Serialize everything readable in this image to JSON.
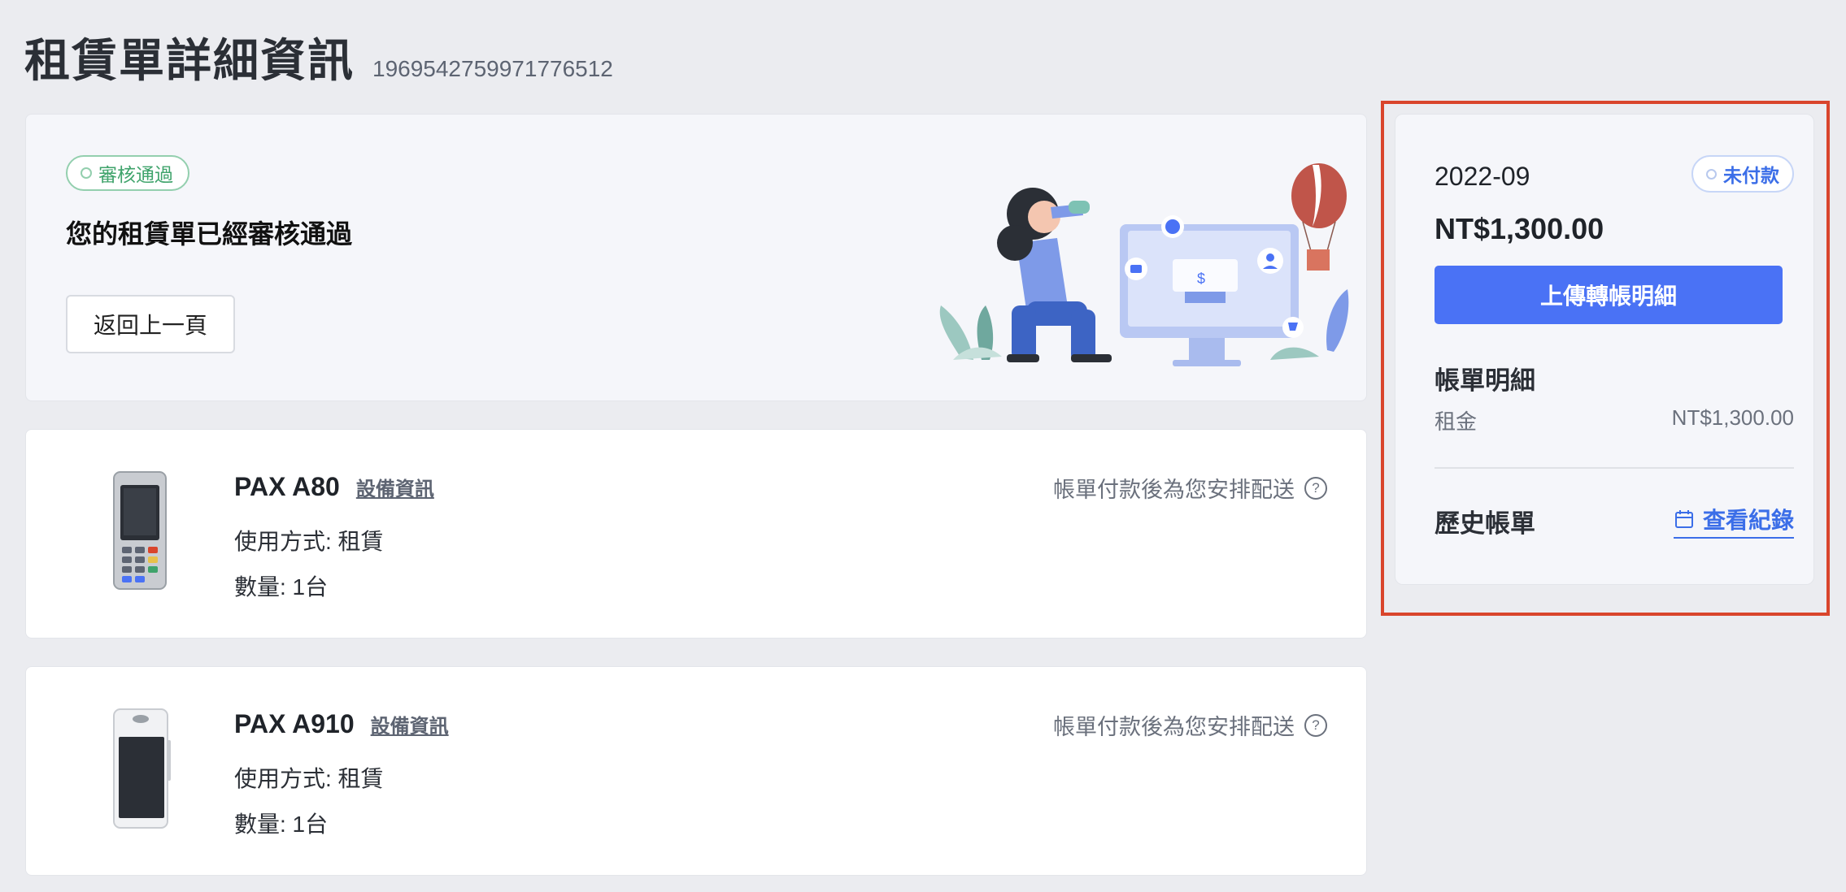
{
  "header": {
    "title": "租賃單詳細資訊",
    "order_id": "1969542759971776512"
  },
  "status_card": {
    "badge": "審核通過",
    "message": "您的租賃單已經審核通過",
    "back_button": "返回上一頁",
    "illustration_icon": "person-with-binoculars-and-monitor-illustration"
  },
  "devices": [
    {
      "name": "PAX A80",
      "info_link": "設備資訊",
      "usage": "使用方式: 租賃",
      "quantity": "數量: 1台",
      "shipping_note": "帳單付款後為您安排配送",
      "icon": "pax-a80-terminal-image"
    },
    {
      "name": "PAX A910",
      "info_link": "設備資訊",
      "usage": "使用方式: 租賃",
      "quantity": "數量: 1台",
      "shipping_note": "帳單付款後為您安排配送",
      "icon": "pax-a910-terminal-image"
    }
  ],
  "bill_panel": {
    "period": "2022-09",
    "status_badge": "未付款",
    "amount": "NT$1,300.00",
    "upload_button": "上傳轉帳明細",
    "details_heading": "帳單明細",
    "line_items": [
      {
        "label": "租金",
        "value": "NT$1,300.00"
      }
    ],
    "history_heading": "歷史帳單",
    "view_records": "查看紀錄"
  },
  "colors": {
    "accent": "#4a72f5",
    "approved": "#3fa36b",
    "highlight": "#d9452c",
    "background": "#ebecf0"
  }
}
